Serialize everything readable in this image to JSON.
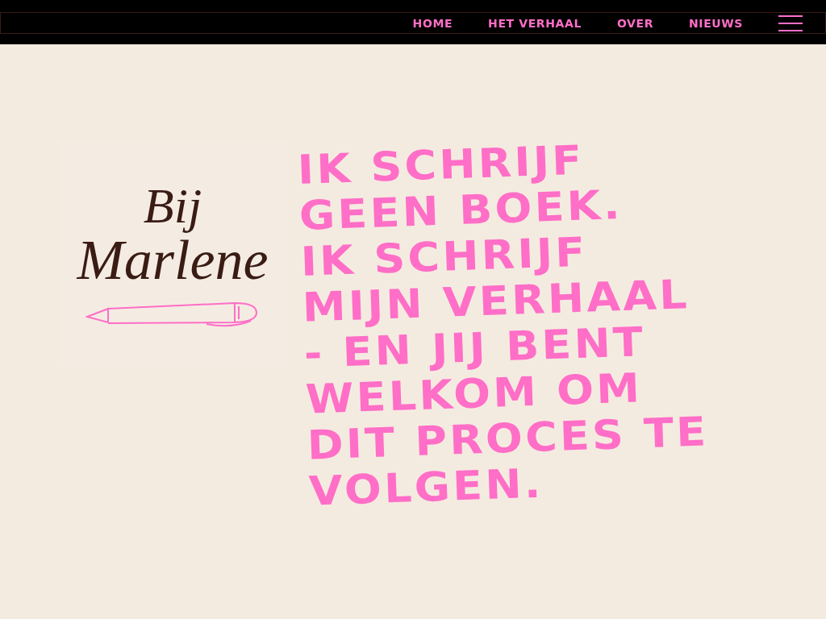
{
  "nav": {
    "items": [
      {
        "label": "HOME"
      },
      {
        "label": "HET VERHAAL"
      },
      {
        "label": "OVER"
      },
      {
        "label": "NIEUWS"
      }
    ]
  },
  "logo": {
    "lines": [
      "Bij",
      "Marlene"
    ]
  },
  "headline": {
    "lines": [
      "IK SCHRIJF",
      "GEEN BOEK.",
      "IK SCHRIJF",
      "MIJN VERHAAL",
      "- EN JIJ BENT",
      "WELKOM OM",
      "DIT PROCES TE",
      "VOLGEN."
    ]
  }
}
